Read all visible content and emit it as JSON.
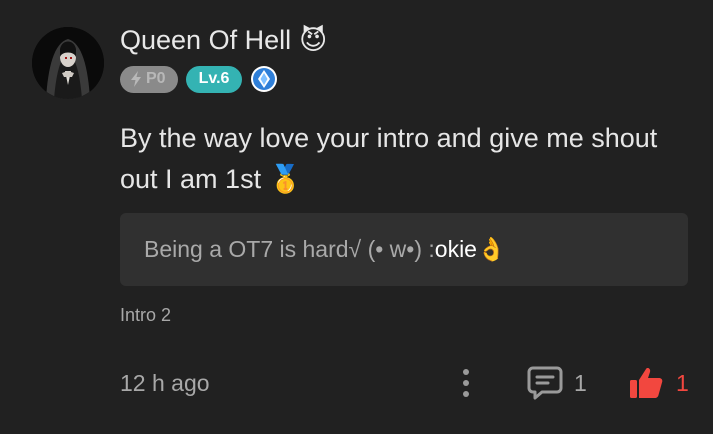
{
  "comment": {
    "username": "Queen Of Hell",
    "username_emoji": "😈",
    "badges": {
      "points_label": "P0",
      "level_label": "Lv.6"
    },
    "text": "By the way love your intro and give me shout out I am 1st",
    "text_emoji": "🥇",
    "quote": {
      "text": "Being a OT7 is hard√ (• w•) : ",
      "highlight": "okie",
      "emoji": "👌"
    },
    "source": "Intro 2",
    "timestamp": "12 h ago",
    "reply_count": "1",
    "like_count": "1"
  },
  "colors": {
    "background": "#212121",
    "level_badge": "#34b3b3",
    "points_badge": "#8a8a8a",
    "like_accent": "#f2473f",
    "quote_background": "#303030"
  },
  "icons": [
    "avatar-image",
    "lightning-icon",
    "gem-badge-icon",
    "more-vertical-icon",
    "comment-bubble-icon",
    "thumbs-up-icon"
  ]
}
